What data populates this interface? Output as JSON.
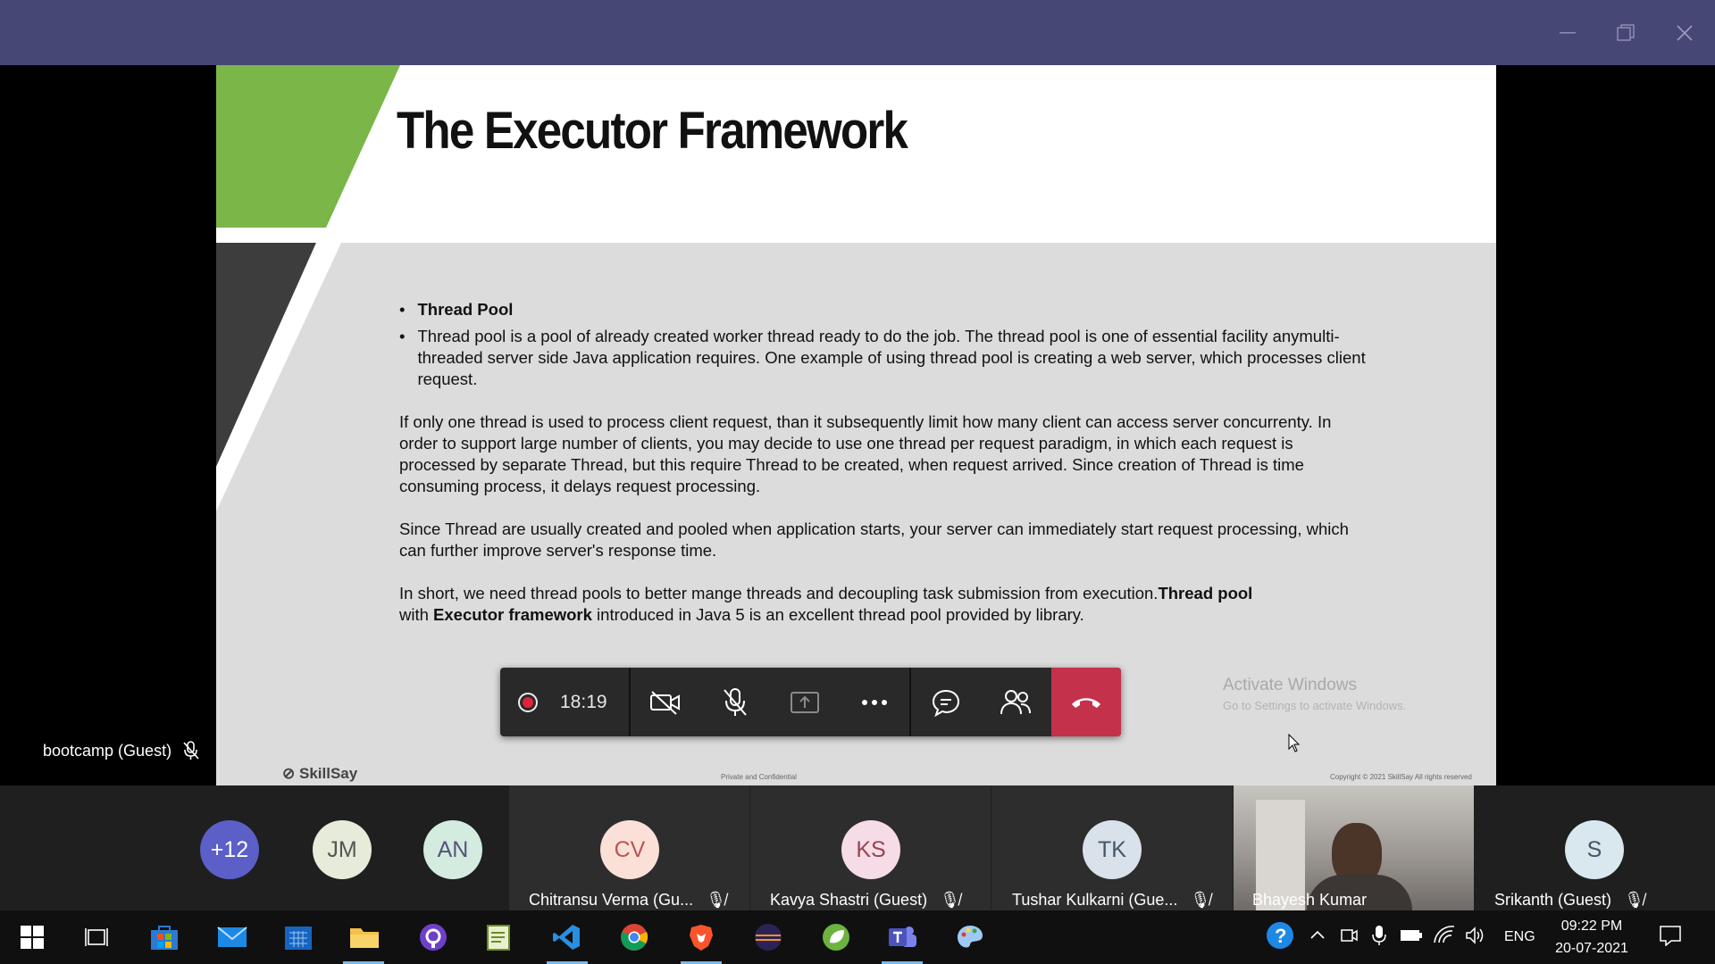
{
  "slide": {
    "title": "The Executor Framework",
    "bullet1": "Thread Pool",
    "bullet2": "Thread pool is a pool of already created worker thread ready to do the job. The thread pool is one of essential facility anymulti-threaded server side Java application requires. One example of using thread pool is creating a web server, which processes client request.",
    "para1": "If only one thread is used to process client request, than it subsequently limit how many client can access server concurrenty. In order to support large number of clients, you may decide to use one thread per request paradigm, in which each request is processed by separate Thread, but this require Thread to be created, when request arrived.  Since creation of Thread is time consuming process, it delays request processing.",
    "para2": "Since Thread are usually created and pooled when application starts, your server can immediately start request processing, which can further improve server's response time.",
    "para3_a": "In short, we need thread pools to better mange threads and decoupling task submission from execution.",
    "para3_b": "Thread pool",
    "para3_c": "with ",
    "para3_d": "Executor framework",
    "para3_e": " introduced in Java 5 is an excellent thread pool provided by library.",
    "footer_logo": "SkillSay",
    "footer_mid": "Private and Confidential",
    "footer_right": "Copyright © 2021 SkillSay All rights reserved",
    "watermark_title": "Activate Windows",
    "watermark_sub": "Go to Settings to activate Windows."
  },
  "controls": {
    "recording_time": "18:19"
  },
  "self_tile": {
    "name": "bootcamp (Guest)"
  },
  "participants": {
    "overflow": "+12",
    "jm": "JM",
    "an": "AN",
    "cv_initials": "CV",
    "cv_name": "Chitransu Verma (Gu...",
    "ks_initials": "KS",
    "ks_name": "Kavya Shastri (Guest)",
    "tk_initials": "TK",
    "tk_name": "Tushar Kulkarni (Gue...",
    "video_name": "Bhayesh Kumar",
    "s_initials": "S",
    "s_name": "Srikanth (Guest)"
  },
  "taskbar": {
    "language": "ENG",
    "time": "09:22 PM",
    "date": "20-07-2021"
  },
  "colors": {
    "titlebar": "#464775",
    "slide_green": "#7ab648",
    "slide_dark": "#3d3d3d",
    "hangup": "#c4314b",
    "recording_dot": "#e0243c"
  }
}
